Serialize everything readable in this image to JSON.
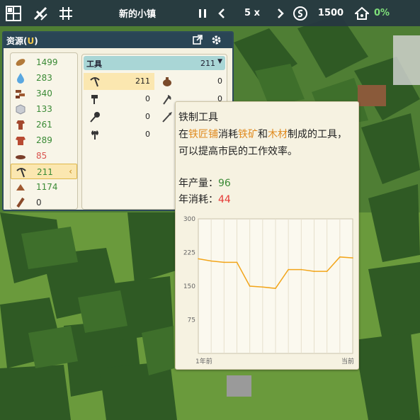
{
  "topbar": {
    "town_name": "新的小镇",
    "speed": "5 x",
    "money": "1500",
    "happiness": "0%"
  },
  "panel": {
    "title_prefix": "资源(",
    "title_key": "U",
    "title_suffix": ")"
  },
  "resources": [
    {
      "icon": "wood-log-icon",
      "value": "1499",
      "status": "normal"
    },
    {
      "icon": "water-drop-icon",
      "value": "283",
      "status": "normal"
    },
    {
      "icon": "bricks-icon",
      "value": "340",
      "status": "normal"
    },
    {
      "icon": "stone-block-icon",
      "value": "133",
      "status": "normal"
    },
    {
      "icon": "clothing-icon",
      "value": "261",
      "status": "normal"
    },
    {
      "icon": "shirt-icon",
      "value": "289",
      "status": "normal"
    },
    {
      "icon": "meat-icon",
      "value": "85",
      "status": "warn"
    },
    {
      "icon": "pickaxe-icon",
      "value": "211",
      "status": "normal",
      "selected": true
    },
    {
      "icon": "firewood-icon",
      "value": "1174",
      "status": "normal"
    },
    {
      "icon": "lumber-icon",
      "value": "0",
      "status": "dark"
    }
  ],
  "tools": {
    "header_label": "工具",
    "header_count": "211",
    "items": [
      {
        "icon": "pickaxe-icon",
        "value": "211",
        "selected": true
      },
      {
        "icon": "pot-icon",
        "value": "0"
      },
      {
        "icon": "hammer-icon",
        "value": "0"
      },
      {
        "icon": "axe-icon",
        "value": "0"
      },
      {
        "icon": "mace-icon",
        "value": "0"
      },
      {
        "icon": "spear-icon",
        "value": "0"
      },
      {
        "icon": "battle-axe-icon",
        "value": "0"
      }
    ]
  },
  "tooltip": {
    "title": "铁制工具",
    "desc": {
      "p1": "在",
      "blacksmith": "铁匠铺",
      "p2": "消耗",
      "iron_ore": "铁矿",
      "p3": "和",
      "timber": "木材",
      "p4": "制成的工具，可以提高市民的工作效率。"
    },
    "production_label": "年产量：",
    "production_value": "96",
    "consumption_label": "年消耗：",
    "consumption_value": "44"
  },
  "colors": {
    "accent_orange": "#e08a1e",
    "positive_green": "#3a8a35",
    "negative_red": "#e53935",
    "line_color": "#f2a51a"
  },
  "chart_data": {
    "type": "line",
    "x_tick_labels": [
      "1年前",
      "当前"
    ],
    "y_ticks": [
      75,
      150,
      225,
      300
    ],
    "ylim": [
      0,
      300
    ],
    "grid": "vertical-only",
    "series": [
      {
        "values": [
          211,
          206,
          203,
          203,
          150,
          148,
          145,
          187,
          187,
          183,
          183,
          215,
          213
        ]
      }
    ]
  }
}
